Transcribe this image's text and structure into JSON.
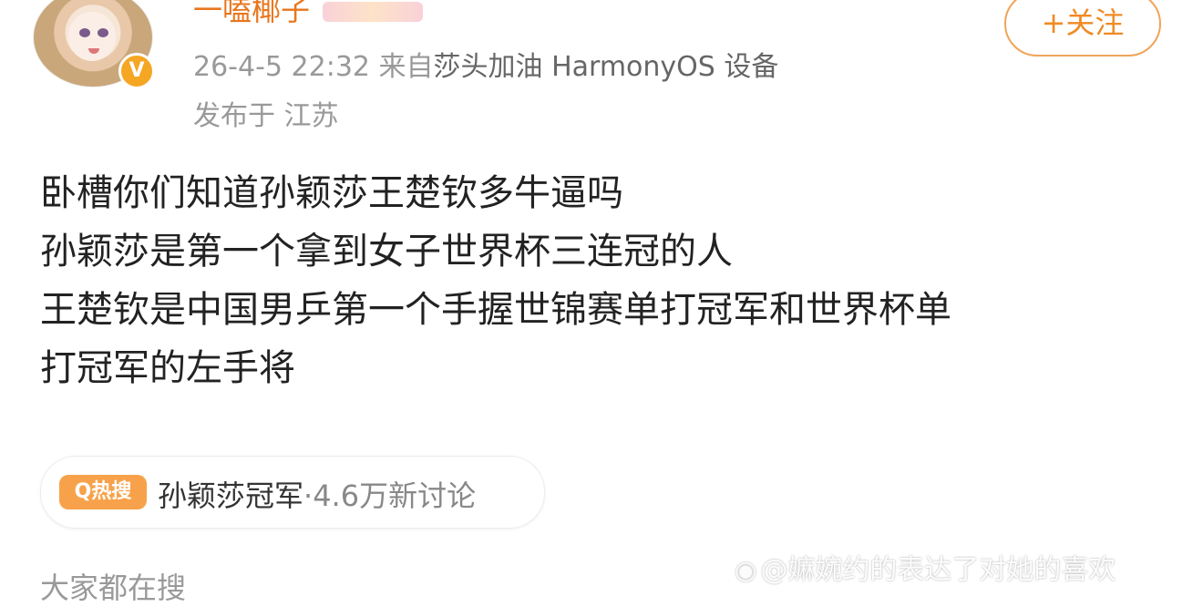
{
  "post": {
    "username": "一嗑椰子",
    "meta": {
      "date": "26-4-5 22:32",
      "source_prefix": "来自",
      "source": "莎头加油 HarmonyOS 设备"
    },
    "location": "发布于 江苏",
    "follow_label": "+关注",
    "verified_badge": "V",
    "content_lines": [
      "卧槽你们知道孙颖莎王楚钦多牛逼吗",
      "孙颖莎是第一个拿到女子世界杯三连冠的人",
      "王楚钦是中国男乒第一个手握世锦赛单打冠军和世界杯单",
      "打冠军的左手将"
    ]
  },
  "hot_search": {
    "badge": "Q热搜",
    "topic": "孙颖莎冠军",
    "count": "·4.6万新讨论"
  },
  "footer": {
    "label": "大家都在搜"
  },
  "watermark": {
    "icon": "weibo-icon",
    "text": "@嫲婉约的表达了对她的喜欢"
  },
  "colors": {
    "accent": "#f08a24",
    "badge": "#f7a24a",
    "verified": "#f5a623"
  }
}
